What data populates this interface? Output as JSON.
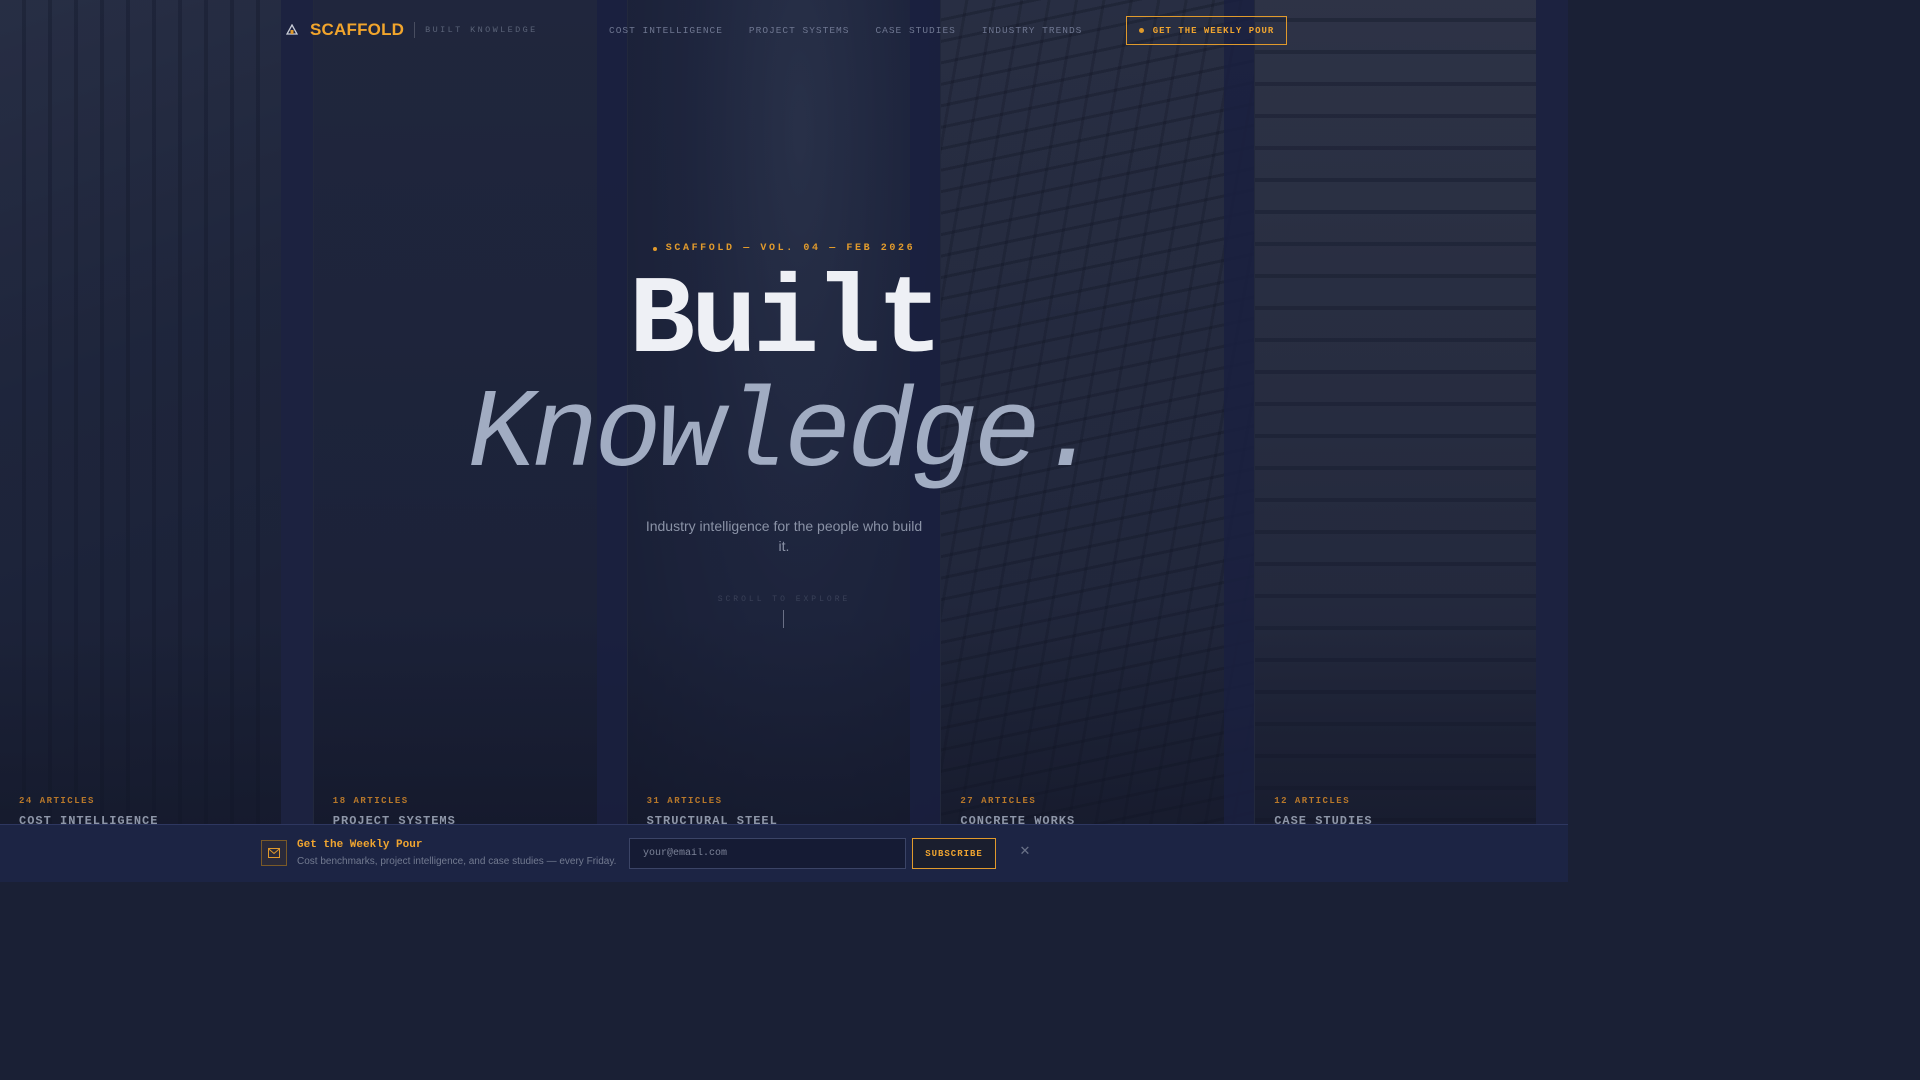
{
  "brand": {
    "name": "SCAFFOLD",
    "tagline": "BUILT KNOWLEDGE"
  },
  "nav": {
    "items": [
      "COST INTELLIGENCE",
      "PROJECT SYSTEMS",
      "CASE STUDIES",
      "INDUSTRY TRENDS"
    ]
  },
  "cta": {
    "label": "GET THE WEEKLY POUR"
  },
  "hero": {
    "kicker": "SCAFFOLD — VOL. 04 — FEB 2026",
    "title_line1": "Built",
    "title_line2": "Knowledge.",
    "subtitle": "Industry intelligence for the people who build it.",
    "scroll_hint": "SCROLL TO EXPLORE"
  },
  "categories": [
    {
      "count": "24 ARTICLES",
      "title": "COST INTELLIGENCE"
    },
    {
      "count": "18 ARTICLES",
      "title": "PROJECT SYSTEMS"
    },
    {
      "count": "31 ARTICLES",
      "title": "STRUCTURAL STEEL"
    },
    {
      "count": "27 ARTICLES",
      "title": "CONCRETE WORKS"
    },
    {
      "count": "12 ARTICLES",
      "title": "CASE STUDIES"
    }
  ],
  "newsletter": {
    "title": "Get the Weekly Pour",
    "description": "Cost benchmarks, project intelligence, and case studies — every Friday.",
    "email_placeholder": "your@email.com",
    "subscribe_label": "SUBSCRIBE",
    "close_glyph": "✕"
  },
  "colors": {
    "accent": "#e09a2c",
    "background": "#1a2035",
    "title": "#eef0f5",
    "title_italic": "#a1acc2"
  }
}
